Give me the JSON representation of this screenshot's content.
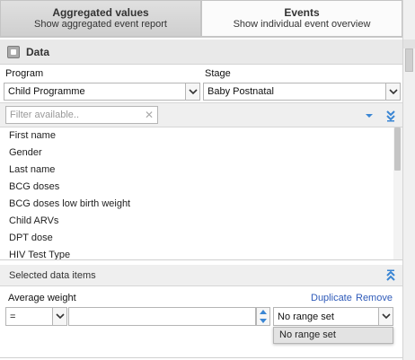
{
  "tabs": [
    {
      "title": "Aggregated values",
      "subtitle": "Show aggregated event report"
    },
    {
      "title": "Events",
      "subtitle": "Show individual event overview"
    }
  ],
  "panel": {
    "title": "Data"
  },
  "program": {
    "label": "Program",
    "value": "Child Programme"
  },
  "stage": {
    "label": "Stage",
    "value": "Baby Postnatal"
  },
  "filter": {
    "placeholder": "Filter available.."
  },
  "available_items": [
    "First name",
    "Gender",
    "Last name",
    "BCG doses",
    "BCG doses low birth weight",
    "Child ARVs",
    "DPT dose",
    "HIV Test Type"
  ],
  "selected": {
    "header": "Selected data items",
    "item": {
      "name": "Average weight",
      "duplicate_label": "Duplicate",
      "remove_label": "Remove",
      "operator": "=",
      "value": "",
      "range_set": "No range set",
      "range_options": [
        "No range set"
      ]
    }
  },
  "colors": {
    "link": "#2e5ab9",
    "tool_icon": "#3a86d4"
  },
  "icons": {
    "data": "data-icon",
    "select_all": "double-chevron-down-icon",
    "deselect_all": "double-chevron-up-icon"
  }
}
